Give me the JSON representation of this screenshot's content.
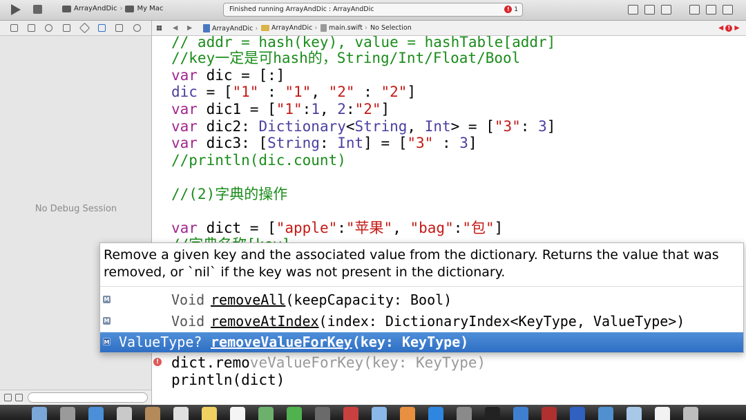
{
  "toolbar": {
    "scheme": "ArrayAndDic",
    "destination": "My Mac",
    "activity": "Finished running ArrayAndDic : ArrayAndDic",
    "error_count": "1"
  },
  "jump_bar": {
    "crumbs": [
      "ArrayAndDic",
      "ArrayAndDic",
      "main.swift",
      "No Selection"
    ]
  },
  "debug": {
    "empty_label": "No Debug Session"
  },
  "code": {
    "lines": [
      "// addr = hash(key), value = hashTable[addr]",
      "//key一定是可hash的，String/Int/Float/Bool",
      "var dic = [:]",
      "dic = [\"1\" : \"1\", \"2\" : \"2\"]",
      "var dic1 = [\"1\":1, 2:\"2\"]",
      "var dic2: Dictionary<String, Int> = [\"3\": 3]",
      "var dic3: [String: Int] = [\"3\" : 3]",
      "//println(dic.count)",
      "",
      "//(2)字典的操作",
      "",
      "var dict = [\"apple\":\"苹果\", \"bag\":\"包\"]",
      "//字典名称[key]"
    ],
    "typed_line": "dict.remo",
    "ghost_completion": "veValueForKey(key: KeyType)",
    "last_line": "println(dict)"
  },
  "completion": {
    "description": "Remove a given key and the associated value from the dictionary. Returns the value that was removed, or `nil` if the key was not present in the dictionary.",
    "items": [
      {
        "badge": "M",
        "return_type": "Void",
        "name": "removeAll",
        "params": "(keepCapacity: Bool)",
        "selected": false
      },
      {
        "badge": "M",
        "return_type": "Void",
        "name": "removeAtIndex",
        "params": "(index: DictionaryIndex<KeyType, ValueType>)",
        "selected": false
      },
      {
        "badge": "M",
        "return_type": "ValueType?",
        "name": "removeValueForKey",
        "params": "(key: KeyType)",
        "selected": true
      }
    ]
  },
  "colors": {
    "comment": "#1a8c1a",
    "keyword": "#a2268e",
    "string": "#c41a16",
    "type": "#4a3fa0",
    "selection": "#3a7bd0"
  },
  "dock": {
    "icons": [
      "finder-icon",
      "launchpad-icon",
      "safari-icon",
      "mail-icon",
      "contacts-icon",
      "calendar-icon",
      "notes-icon",
      "reminders-icon",
      "maps-icon",
      "messages-icon",
      "facetime-icon",
      "photobooth-icon",
      "itunes-icon",
      "ibooks-icon",
      "appstore-icon",
      "system-preferences-icon",
      "terminal-icon",
      "xcode-icon",
      "video-icon",
      "word-icon",
      "browser-icon",
      "preview-icon",
      "textedit-icon",
      "trash-icon"
    ]
  }
}
